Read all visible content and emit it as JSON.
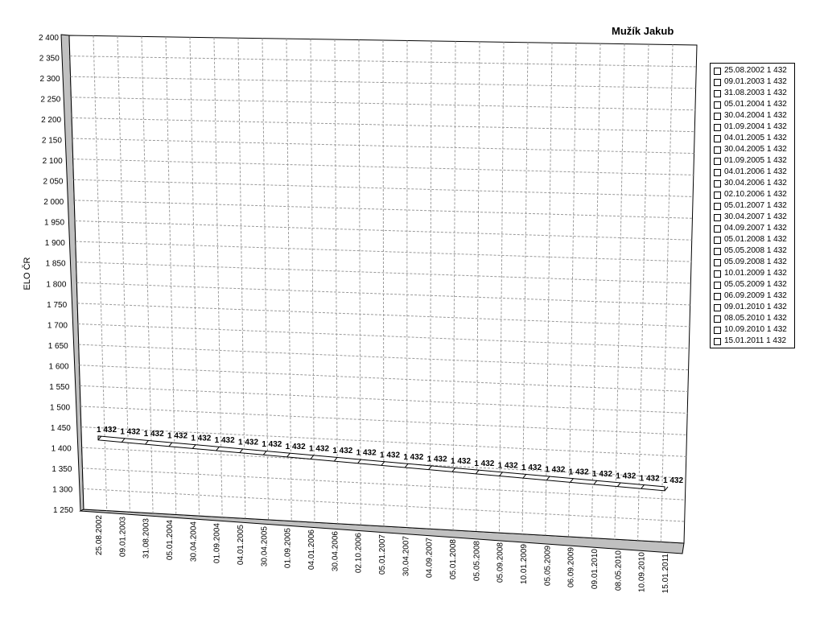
{
  "chart_data": {
    "type": "line",
    "title": "Mužík Jakub",
    "ylabel": "ELO ČR",
    "xlabel": "",
    "ylim": [
      1250,
      2400
    ],
    "yticks": [
      "2 400",
      "2 350",
      "2 300",
      "2 250",
      "2 200",
      "2 150",
      "2 100",
      "2 050",
      "2 000",
      "1 950",
      "1 900",
      "1 850",
      "1 800",
      "1 750",
      "1 700",
      "1 650",
      "1 600",
      "1 550",
      "1 500",
      "1 450",
      "1 400",
      "1 350",
      "1 300",
      "1 250"
    ],
    "grid": true,
    "legend": "right",
    "categories": [
      "25.08.2002",
      "09.01.2003",
      "31.08.2003",
      "05.01.2004",
      "30.04.2004",
      "01.09.2004",
      "04.01.2005",
      "30.04.2005",
      "01.09.2005",
      "04.01.2006",
      "30.04.2006",
      "02.10.2006",
      "05.01.2007",
      "30.04.2007",
      "04.09.2007",
      "05.01.2008",
      "05.05.2008",
      "05.09.2008",
      "10.01.2009",
      "05.05.2009",
      "06.09.2009",
      "09.01.2010",
      "08.05.2010",
      "10.09.2010",
      "15.01.2011"
    ],
    "values": [
      1432,
      1432,
      1432,
      1432,
      1432,
      1432,
      1432,
      1432,
      1432,
      1432,
      1432,
      1432,
      1432,
      1432,
      1432,
      1432,
      1432,
      1432,
      1432,
      1432,
      1432,
      1432,
      1432,
      1432,
      1432
    ],
    "data_labels": [
      "1 432",
      "1 432",
      "1 432",
      "1 432",
      "1 432",
      "1 432",
      "1 432",
      "1 432",
      "1 432",
      "1 432",
      "1 432",
      "1 432",
      "1 432",
      "1 432",
      "1 432",
      "1 432",
      "1 432",
      "1 432",
      "1 432",
      "1 432",
      "1 432",
      "1 432",
      "1 432",
      "1 432",
      "1 432"
    ],
    "legend_entries": [
      "25.08.2002 1 432",
      "09.01.2003 1 432",
      "31.08.2003 1 432",
      "05.01.2004 1 432",
      "30.04.2004 1 432",
      "01.09.2004 1 432",
      "04.01.2005 1 432",
      "30.04.2005 1 432",
      "01.09.2005 1 432",
      "04.01.2006 1 432",
      "30.04.2006 1 432",
      "02.10.2006 1 432",
      "05.01.2007 1 432",
      "30.04.2007 1 432",
      "04.09.2007 1 432",
      "05.01.2008 1 432",
      "05.05.2008 1 432",
      "05.09.2008 1 432",
      "10.01.2009 1 432",
      "05.05.2009 1 432",
      "06.09.2009 1 432",
      "09.01.2010 1 432",
      "08.05.2010 1 432",
      "10.09.2010 1 432",
      "15.01.2011 1 432"
    ]
  }
}
